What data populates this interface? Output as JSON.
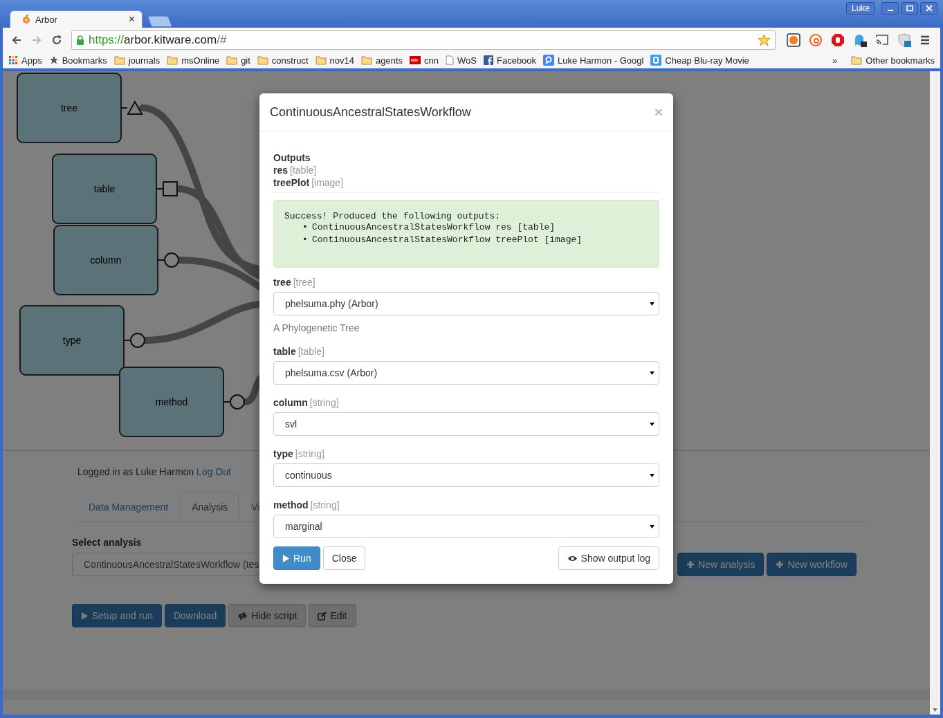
{
  "browser": {
    "tabs": [
      {
        "title": "Arbor",
        "close": "×",
        "selected": true
      }
    ],
    "user": "Luke",
    "url": {
      "scheme": "https://",
      "host": "arbor.kitware.com",
      "path": "/#"
    },
    "bookmarks": [
      {
        "label": "Apps",
        "kind": "apps"
      },
      {
        "label": "Bookmarks",
        "kind": "star"
      },
      {
        "label": "journals",
        "kind": "folder"
      },
      {
        "label": "msOnline",
        "kind": "folder"
      },
      {
        "label": "git",
        "kind": "folder"
      },
      {
        "label": "construct",
        "kind": "folder"
      },
      {
        "label": "nov14",
        "kind": "folder"
      },
      {
        "label": "agents",
        "kind": "folder"
      },
      {
        "label": "cnn",
        "kind": "news"
      },
      {
        "label": "WoS",
        "kind": "page"
      },
      {
        "label": "Facebook",
        "kind": "social"
      },
      {
        "label": "Luke Harmon - Googl",
        "kind": "scholar"
      },
      {
        "label": "Cheap Blu-ray Movie",
        "kind": "blog"
      }
    ],
    "overflow": "»",
    "other_bookmarks": "Other bookmarks"
  },
  "workflow": {
    "nodes": [
      {
        "label": "tree",
        "kind": "triangle"
      },
      {
        "label": "table",
        "kind": "square"
      },
      {
        "label": "column",
        "kind": "circle"
      },
      {
        "label": "type",
        "kind": "circle"
      },
      {
        "label": "method",
        "kind": "circle"
      }
    ]
  },
  "page": {
    "login_text": "Logged in as Luke Harmon",
    "logout": "Log Out",
    "tabs": [
      {
        "label": "Data Management",
        "selected": false
      },
      {
        "label": "Analysis",
        "selected": true
      },
      {
        "label": "Vi",
        "selected": false
      }
    ],
    "select_label": "Select analysis",
    "select_value": "ContinuousAncestralStatesWorkflow (tes",
    "actions": [
      {
        "label": "New analysis"
      },
      {
        "label": "New workflow"
      }
    ],
    "buttons": [
      {
        "label": "Setup and run",
        "kind": "run"
      },
      {
        "label": "Download",
        "kind": "download"
      },
      {
        "label": "Hide script",
        "kind": "toggle"
      },
      {
        "label": "Edit",
        "kind": "edit"
      }
    ]
  },
  "modal": {
    "title": "ContinuousAncestralStatesWorkflow",
    "close": "×",
    "outputs_heading": "Outputs",
    "outputs": [
      {
        "name": "res",
        "type": "[table]"
      },
      {
        "name": "treePlot",
        "type": "[image]"
      }
    ],
    "alert": {
      "heading": "Success! Produced the following outputs:",
      "bullet": "•",
      "items": [
        "ContinuousAncestralStatesWorkflow res [table]",
        "ContinuousAncestralStatesWorkflow treePlot [image]"
      ]
    },
    "inputs": [
      {
        "name": "tree",
        "type": "[tree]",
        "value": "phelsuma.phy (Arbor)",
        "help": "A Phylogenetic Tree"
      },
      {
        "name": "table",
        "type": "[table]",
        "value": "phelsuma.csv (Arbor)"
      },
      {
        "name": "column",
        "type": "[string]",
        "value": "svl"
      },
      {
        "name": "type",
        "type": "[string]",
        "value": "continuous"
      },
      {
        "name": "method",
        "type": "[string]",
        "value": "marginal"
      }
    ],
    "buttons": [
      {
        "label": "Run",
        "kind": "run"
      },
      {
        "label": "Close",
        "kind": "close"
      }
    ],
    "log_button": "Show output log"
  }
}
